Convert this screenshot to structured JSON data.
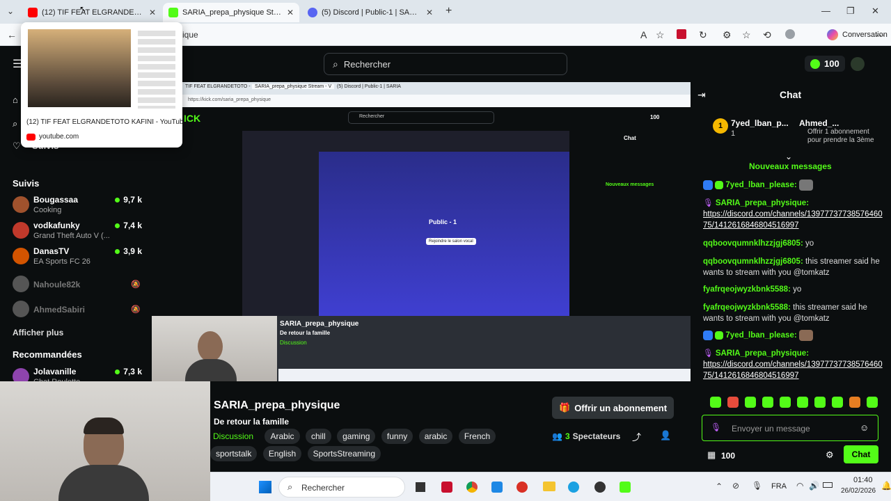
{
  "browser": {
    "tabs": [
      {
        "label": "(12) TIF FEAT ELGRANDETOTO - KA",
        "icon": "youtube-icon"
      },
      {
        "label": "SARIA_prepa_physique Stream - V",
        "icon": "kick-icon"
      },
      {
        "label": "(5) Discord | Public-1 | SARIA",
        "icon": "discord-icon"
      }
    ],
    "address_fragment": "ique",
    "profile_label": "Conversation"
  },
  "preview": {
    "title": "(12) TIF FEAT ELGRANDETOTO   KAFINI - YouTube",
    "site": "youtube.com"
  },
  "kick": {
    "search_placeholder": "Rechercher",
    "points": "100",
    "sidebar": {
      "following_label": "Suivis",
      "following_partial": "Suivis",
      "show_more": "Afficher plus",
      "recommended_label": "Recommandées",
      "channels": [
        {
          "name": "Bougassaa",
          "game": "Cooking",
          "viewers": "9,7 k",
          "live": true,
          "color": "#a0522d"
        },
        {
          "name": "vodkafunky",
          "game": "Grand Theft Auto V (...",
          "viewers": "7,4 k",
          "live": true,
          "color": "#c0392b"
        },
        {
          "name": "DanasTV",
          "game": "EA Sports FC 26",
          "viewers": "3,9 k",
          "live": true,
          "color": "#d35400"
        },
        {
          "name": "Nahoule82k",
          "game": "",
          "viewers": "",
          "live": false,
          "color": "#555"
        },
        {
          "name": "AhmedSabiri",
          "game": "",
          "viewers": "",
          "live": false,
          "color": "#555"
        }
      ],
      "recommended": [
        {
          "name": "Jolavanille",
          "game": "Chat Roulette",
          "viewers": "7,3 k",
          "color": "#8e44ad"
        }
      ]
    },
    "stream": {
      "streamer": "SARIA_prepa_physique",
      "title": "De retour la famille",
      "category": "Discussion",
      "tags": [
        "Arabic",
        "chill",
        "gaming",
        "funny",
        "arabic",
        "French",
        "sportstalk",
        "English",
        "SportsStreaming"
      ],
      "subscribe_label": "Offrir un abonnement",
      "viewers_count": "3",
      "viewers_label": "Spectateurs"
    },
    "chat": {
      "header": "Chat",
      "pinned_user": "Ahmed_...",
      "pinned_text": "Offrir 1 abonnement pour prendre la 3ème",
      "gifter_name": "7yed_lban_p...",
      "gifter_count": "1",
      "new_messages_label": "Nouveaux messages",
      "messages": [
        {
          "user": "7yed_lban_please",
          "text": "",
          "color": "#53fc18"
        },
        {
          "user": "SARIA_prepa_physique",
          "text": "https://discord.com/channels/1397773773857646075/1412616846804516997",
          "color": "#53fc18"
        },
        {
          "user": "qqboovqumnklhzzjgj6805",
          "text": "yo",
          "color": "#53fc18"
        },
        {
          "user": "qqboovqumnklhzzjgj6805",
          "text": "this streamer said he wants to stream with you @tomkatz",
          "color": "#53fc18"
        },
        {
          "user": "fyafrqeojwyzkbnk5588",
          "text": "yo",
          "color": "#53fc18"
        },
        {
          "user": "fyafrqeojwyzkbnk5588",
          "text": "this streamer said he wants to stream with you @tomkatz",
          "color": "#53fc18"
        },
        {
          "user": "7yed_lban_please",
          "text": "",
          "color": "#53fc18"
        },
        {
          "user": "SARIA_prepa_physique",
          "text": "https://discord.com/channels/1397773773857646075/1412616846804516997",
          "color": "#53fc18"
        }
      ],
      "input_placeholder": "Envoyer un message",
      "balance": "100",
      "send_label": "Chat"
    }
  },
  "inner": {
    "tabs": [
      "TIF FEAT ELGRANDETOTO - K",
      "SARIA_prepa_physique Stream - V",
      "(5) Discord | Public-1 | SARIA"
    ],
    "address": "https://kick.com/saria_prepa_physique",
    "search": "Rechercher",
    "points": "100",
    "chat_header": "Chat",
    "new_messages": "Nouveaux messages",
    "streamer": "SARIA_prepa_physique",
    "title": "De retour la famille",
    "category": "Discussion",
    "discord_channel": "Public - 1",
    "discord_join": "Rejoindre le salon vocal"
  },
  "taskbar": {
    "search": "Rechercher",
    "lang": "FRA",
    "time": "01:40",
    "date": "26/02/2026"
  },
  "colors": {
    "kick_green": "#53fc18",
    "bg": "#0b0e0f"
  }
}
